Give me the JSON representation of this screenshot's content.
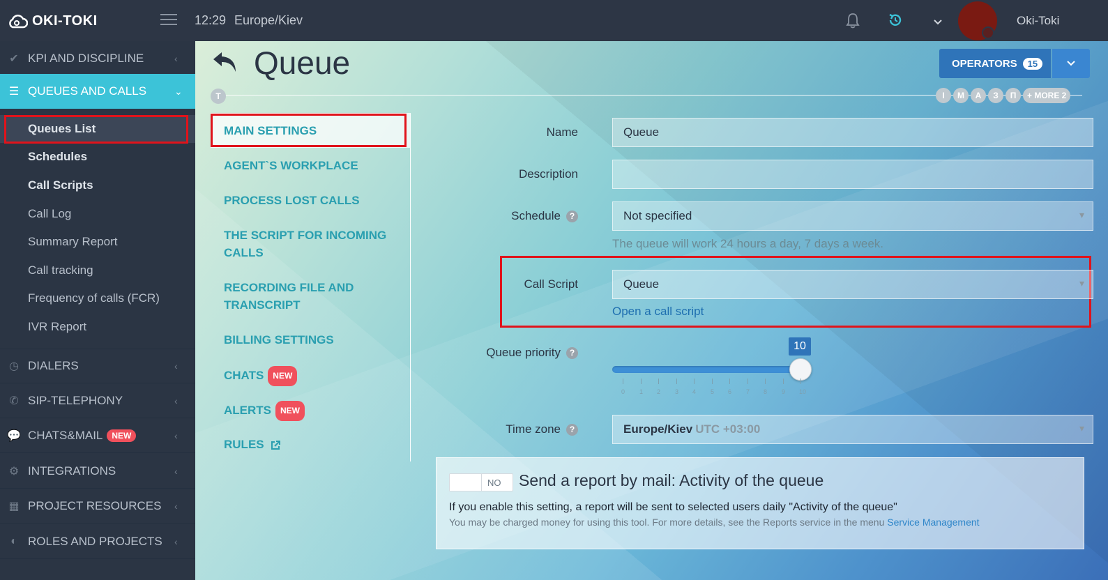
{
  "header": {
    "logo_text": "OKI-TOKI",
    "time": "12:29",
    "timezone": "Europe/Kiev",
    "username": "Oki-Toki"
  },
  "sidebar": {
    "sections": [
      {
        "label": "KPI AND DISCIPLINE",
        "icon": "check-icon"
      },
      {
        "label": "QUEUES AND CALLS",
        "icon": "list-icon"
      },
      {
        "label": "DIALERS",
        "icon": "clock-icon"
      },
      {
        "label": "SIP-TELEPHONY",
        "icon": "phone-icon"
      },
      {
        "label": "CHATS&MAIL",
        "icon": "chat-icon",
        "badge": "NEW"
      },
      {
        "label": "INTEGRATIONS",
        "icon": "gears-icon"
      },
      {
        "label": "PROJECT RESOURCES",
        "icon": "grid-icon"
      },
      {
        "label": "ROLES AND PROJECTS",
        "icon": "toggle-icon"
      }
    ],
    "sub_items": [
      {
        "label": "Queues List"
      },
      {
        "label": "Schedules"
      },
      {
        "label": "Call Scripts"
      },
      {
        "label": "Call Log"
      },
      {
        "label": "Summary Report"
      },
      {
        "label": "Call tracking"
      },
      {
        "label": "Frequency of calls (FCR)"
      },
      {
        "label": "IVR Report"
      }
    ]
  },
  "main": {
    "title": "Queue",
    "operators_label": "OPERATORS",
    "operators_count": "15",
    "tag_left": "T",
    "tags_right": [
      "I",
      "M",
      "A",
      "З",
      "П",
      "+ MORE 2"
    ],
    "tabs": [
      {
        "label": "MAIN SETTINGS"
      },
      {
        "label": "AGENT`S WORKPLACE"
      },
      {
        "label": "PROCESS LOST CALLS"
      },
      {
        "label": "THE SCRIPT FOR INCOMING CALLS"
      },
      {
        "label": "RECORDING FILE AND TRANSCRIPT"
      },
      {
        "label": "BILLING SETTINGS"
      },
      {
        "label": "CHATS",
        "badge": "NEW"
      },
      {
        "label": "ALERTS",
        "badge": "NEW"
      },
      {
        "label": "RULES"
      }
    ],
    "form": {
      "name_label": "Name",
      "name_value": "Queue",
      "description_label": "Description",
      "description_value": "",
      "schedule_label": "Schedule",
      "schedule_value": "Not specified",
      "schedule_hint": "The queue will work 24 hours a day, 7 days a week.",
      "call_script_label": "Call Script",
      "call_script_value": "Queue",
      "call_script_link": "Open a call script",
      "priority_label": "Queue priority",
      "priority_value": "10",
      "priority_fraction": 1.0,
      "priority_ticks": [
        "0",
        "1",
        "2",
        "3",
        "4",
        "5",
        "6",
        "7",
        "8",
        "9",
        "10"
      ],
      "timezone_label": "Time zone",
      "timezone_value": "Europe/Kiev",
      "timezone_utc": "UTC +03:00"
    },
    "report": {
      "toggle_label": "NO",
      "title": "Send a report by mail: Activity of the queue",
      "description": "If you enable this setting, a report will be sent to selected users daily \"Activity of the queue\"",
      "note": "You may be charged money for using this tool. For more details, see the Reports service in the menu",
      "note_link": "Service Management"
    }
  }
}
